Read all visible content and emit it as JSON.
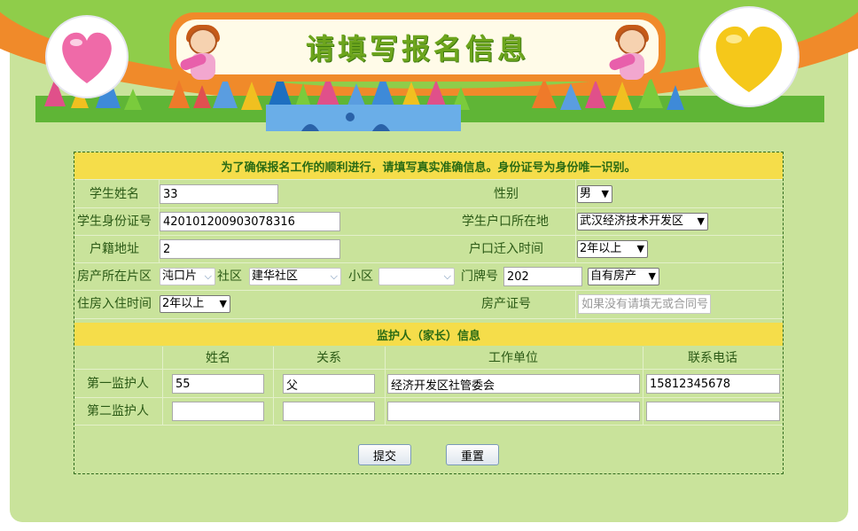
{
  "banner": {
    "title": "请填写报名信息"
  },
  "notice": "为了确保报名工作的顺利进行，请填写真实准确信息。身份证号为身份唯一识别。",
  "student": {
    "name_label": "学生姓名",
    "name_value": "33",
    "gender_label": "性别",
    "gender_value": "男",
    "id_label": "学生身份证号",
    "id_value": "420101200903078316",
    "hukou_place_label": "学生户口所在地",
    "hukou_place_value": "武汉经济技术开发区",
    "household_addr_label": "户籍地址",
    "household_addr_value": "2",
    "hukou_move_label": "户口迁入时间",
    "hukou_move_value": "2年以上",
    "area_label": "房产所在片区",
    "area_value": "沌口片",
    "community_label": "社区",
    "community_value": "建华社区",
    "district_label": "小区",
    "district_value": "",
    "door_label": "门牌号",
    "door_value": "202",
    "property_type_value": "自有房产",
    "move_in_label": "住房入住时间",
    "move_in_value": "2年以上",
    "cert_label": "房产证号",
    "cert_placeholder": "如果没有请填无或合同号"
  },
  "guardians": {
    "section_title": "监护人（家长）信息",
    "columns": [
      "姓名",
      "关系",
      "工作单位",
      "联系电话"
    ],
    "rows": [
      {
        "label": "第一监护人",
        "name": "55",
        "relation": "父",
        "work": "经济开发区社管委会",
        "phone": "15812345678"
      },
      {
        "label": "第二监护人",
        "name": "",
        "relation": "",
        "work": "",
        "phone": ""
      }
    ]
  },
  "buttons": {
    "submit": "提交",
    "reset": "重置"
  }
}
